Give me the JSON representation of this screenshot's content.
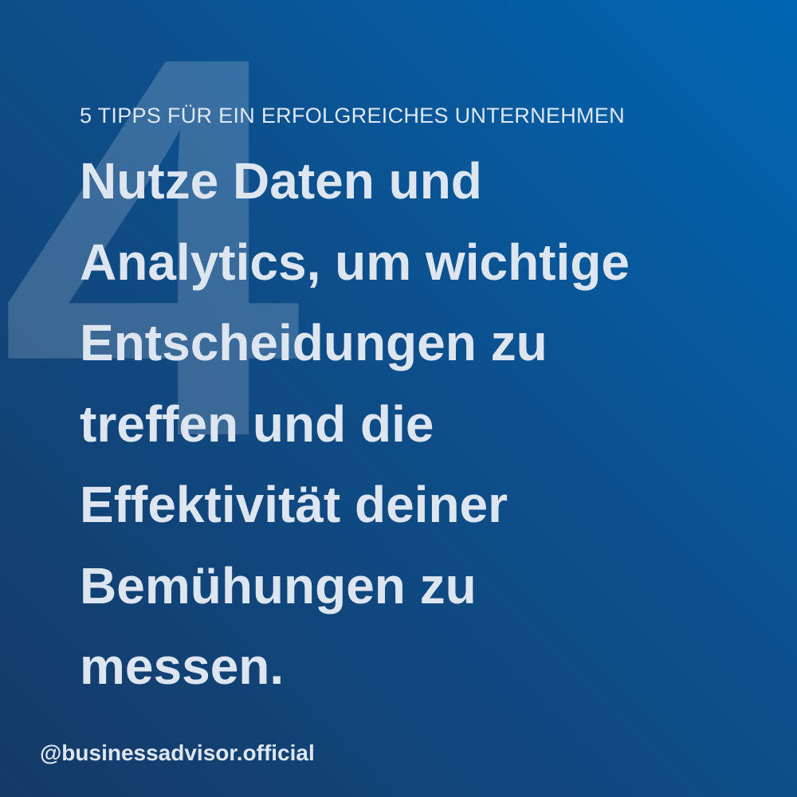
{
  "background": {
    "gradient_colors": [
      "#0066b3",
      "#0d4f8c",
      "#153a66"
    ]
  },
  "tip_number": "4",
  "series_title": "5 TIPPS FÜR EIN ERFOLGREICHES UNTERNEHMEN",
  "headline_lines": [
    "Nutze Daten und",
    "Analytics, um wichtige",
    "Entscheidungen zu",
    "treffen und die",
    "Effektivität deiner",
    "Bemühungen zu",
    "messen."
  ],
  "handle": "@businessadvisor.official",
  "text_color": "#dde6f0"
}
